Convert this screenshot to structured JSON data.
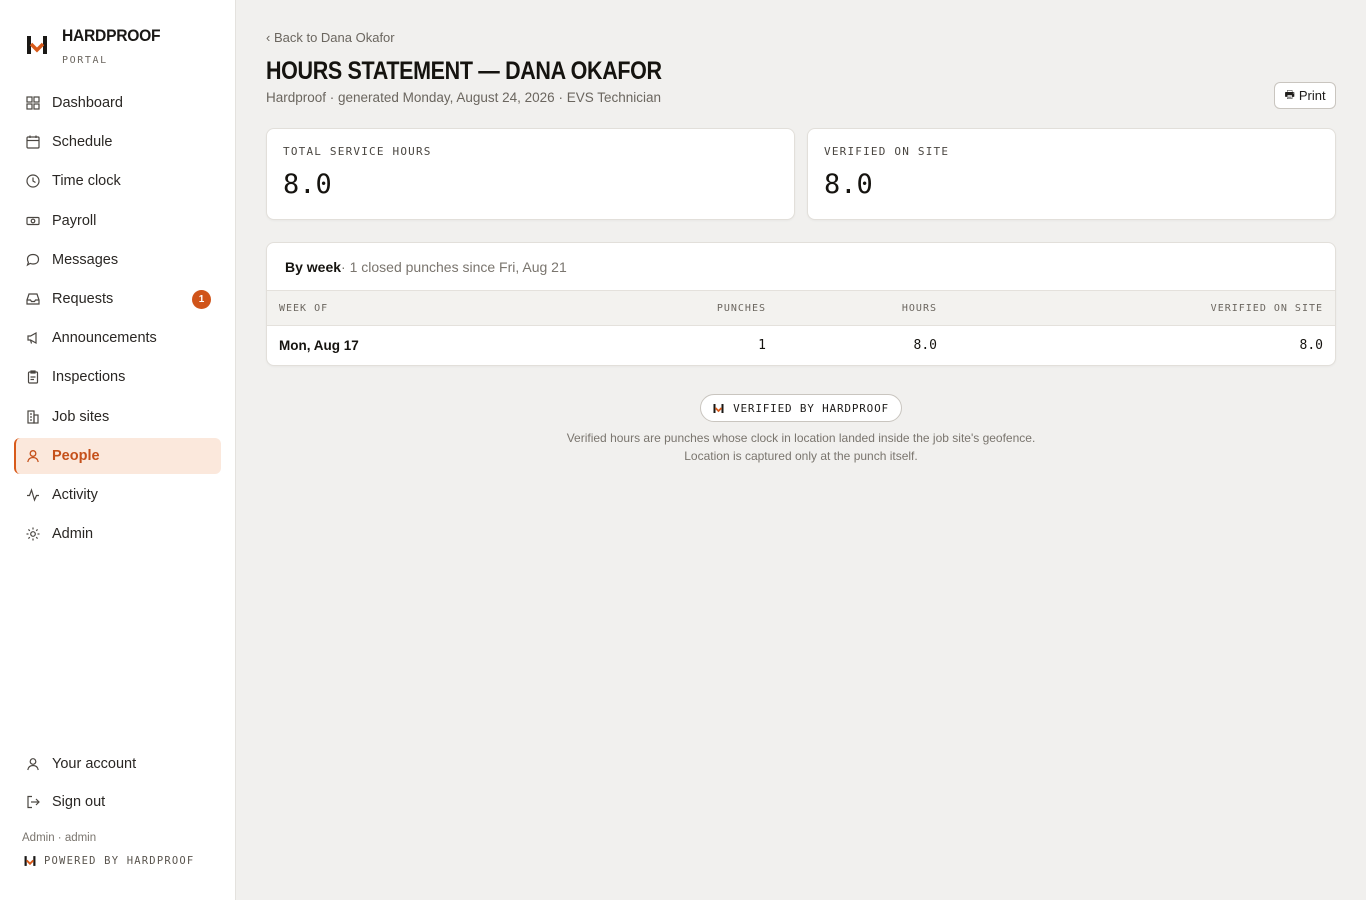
{
  "brand": {
    "name": "HARDPROOF",
    "sub": "PORTAL"
  },
  "accent": "#d85a1a",
  "nav": [
    {
      "label": "Dashboard",
      "icon": "grid-icon"
    },
    {
      "label": "Schedule",
      "icon": "calendar-icon"
    },
    {
      "label": "Time clock",
      "icon": "clock-icon"
    },
    {
      "label": "Payroll",
      "icon": "banknote-icon"
    },
    {
      "label": "Messages",
      "icon": "chat-bubble-icon"
    },
    {
      "label": "Requests",
      "icon": "inbox-icon",
      "badge": "1"
    },
    {
      "label": "Announcements",
      "icon": "megaphone-icon"
    },
    {
      "label": "Inspections",
      "icon": "clipboard-icon"
    },
    {
      "label": "Job sites",
      "icon": "building-icon"
    },
    {
      "label": "People",
      "icon": "user-icon",
      "active": true
    },
    {
      "label": "Activity",
      "icon": "activity-icon"
    },
    {
      "label": "Admin",
      "icon": "sun-gear-icon"
    }
  ],
  "nav_bottom": [
    {
      "label": "Your account",
      "icon": "user-icon"
    },
    {
      "label": "Sign out",
      "icon": "sign-out-icon"
    }
  ],
  "footer": {
    "user": "Admin · admin",
    "powered": "POWERED BY HARDPROOF"
  },
  "page": {
    "back": "‹ Back to Dana Okafor",
    "title": "HOURS STATEMENT — DANA OKAFOR",
    "subtitle": "Hardproof · generated Monday, August 24, 2026 · EVS Technician",
    "print": "Print"
  },
  "stats": [
    {
      "label": "TOTAL SERVICE HOURS",
      "value": "8.0"
    },
    {
      "label": "VERIFIED ON SITE",
      "value": "8.0"
    }
  ],
  "table": {
    "title": "By week",
    "subtitle": " · 1 closed punches since Fri, Aug 21",
    "columns": {
      "week": "WEEK OF",
      "punches": "PUNCHES",
      "hours": "HOURS",
      "verified": "VERIFIED ON SITE"
    },
    "rows": [
      {
        "week": "Mon, Aug 17",
        "punches": "1",
        "hours": "8.0",
        "verified": "8.0"
      }
    ]
  },
  "verified_badge": "VERIFIED BY HARDPROOF",
  "notes": [
    "Verified hours are punches whose clock in location landed inside the job site's geofence.",
    "Location is captured only at the punch itself."
  ]
}
